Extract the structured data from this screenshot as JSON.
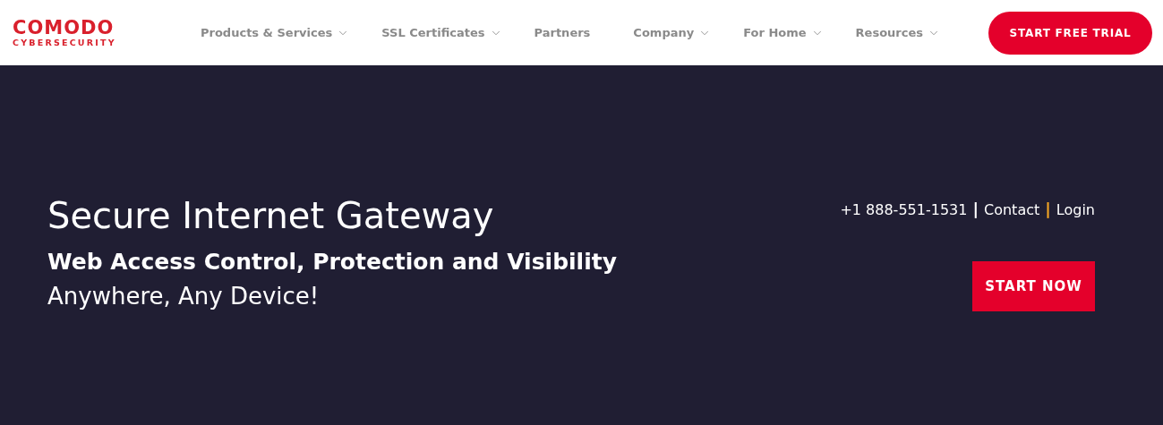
{
  "logo": {
    "name": "COMODO",
    "tagline": "CYBERSECURITY"
  },
  "nav": [
    {
      "label": "Products & Services",
      "has_dropdown": true
    },
    {
      "label": "SSL Certificates",
      "has_dropdown": true
    },
    {
      "label": "Partners",
      "has_dropdown": false
    },
    {
      "label": "Company",
      "has_dropdown": true
    },
    {
      "label": "For Home",
      "has_dropdown": true
    },
    {
      "label": "Resources",
      "has_dropdown": true
    }
  ],
  "trial_button": "START FREE TRIAL",
  "hero": {
    "title": "Secure Internet Gateway",
    "subtitle": "Web Access Control, Protection and Visibility",
    "tagline": "Anywhere, Any Device!",
    "contact_links": [
      {
        "kind": "text",
        "text": "+1 888-551-1531"
      },
      {
        "kind": "separator",
        "text": "|",
        "color": "#ffffff"
      },
      {
        "kind": "link",
        "text": "Contact"
      },
      {
        "kind": "separator",
        "text": "|",
        "color": "#f5a623"
      },
      {
        "kind": "link",
        "text": "Login"
      }
    ],
    "cta_button": "START NOW"
  }
}
